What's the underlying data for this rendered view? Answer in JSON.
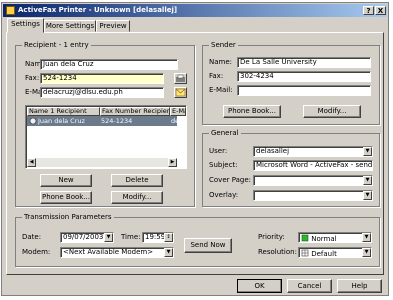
{
  "window": {
    "title": "ActiveFax Printer - Unknown [delasallej]",
    "help_btn": "?",
    "close_btn": "X"
  },
  "tabs": [
    {
      "label": "Settings"
    },
    {
      "label": "More Settings"
    },
    {
      "label": "Preview"
    }
  ],
  "recipient": {
    "group_label": "Recipient - 1 entry",
    "name_label": "Name:",
    "name_value": "Juan dela Cruz",
    "fax_label": "Fax:",
    "fax_value": "524-1234",
    "email_label": "E-Mail:",
    "email_value": "delacruzj@dlsu.edu.ph",
    "columns": [
      "Name 1 Recipient",
      "Fax Number Recipient",
      "E-Mail"
    ],
    "rows": [
      {
        "name": "Juan dela Cruz",
        "fax": "524-1234",
        "email": "dela"
      }
    ],
    "new_btn": "New",
    "delete_btn": "Delete",
    "phonebook_btn": "Phone Book...",
    "modify_btn": "Modify..."
  },
  "sender": {
    "group_label": "Sender",
    "name_label": "Name:",
    "name_value": "De La Salle University",
    "fax_label": "Fax:",
    "fax_value": "302-4234",
    "email_label": "E-Mail:",
    "email_value": "",
    "phonebook_btn": "Phone Book...",
    "modify_btn": "Modify..."
  },
  "general": {
    "group_label": "General",
    "user_label": "User:",
    "user_value": "delasallej",
    "subject_label": "Subject:",
    "subject_value": "Microsoft Word - ActiveFax - send fa",
    "cover_label": "Cover Page:",
    "cover_value": "",
    "overlay_label": "Overlay:",
    "overlay_value": ""
  },
  "transmission": {
    "group_label": "Transmission Parameters",
    "date_label": "Date:",
    "date_value": "09/07/2003",
    "time_label": "Time:",
    "time_value": "19:59",
    "modem_label": "Modem:",
    "modem_value": "<Next Available Modem>",
    "send_now_btn": "Send Now",
    "priority_label": "Priority:",
    "priority_value": "Normal",
    "resolution_label": "Resolution:",
    "resolution_value": "Default"
  },
  "footer": {
    "ok_btn": "OK",
    "cancel_btn": "Cancel",
    "help_btn": "Help"
  },
  "colors": {
    "title_start": "#0a246a",
    "title_end": "#a6caf0",
    "face": "#d4d0c8",
    "fax_field": "#ffffc8",
    "selected_row": "#6b7b8c"
  }
}
